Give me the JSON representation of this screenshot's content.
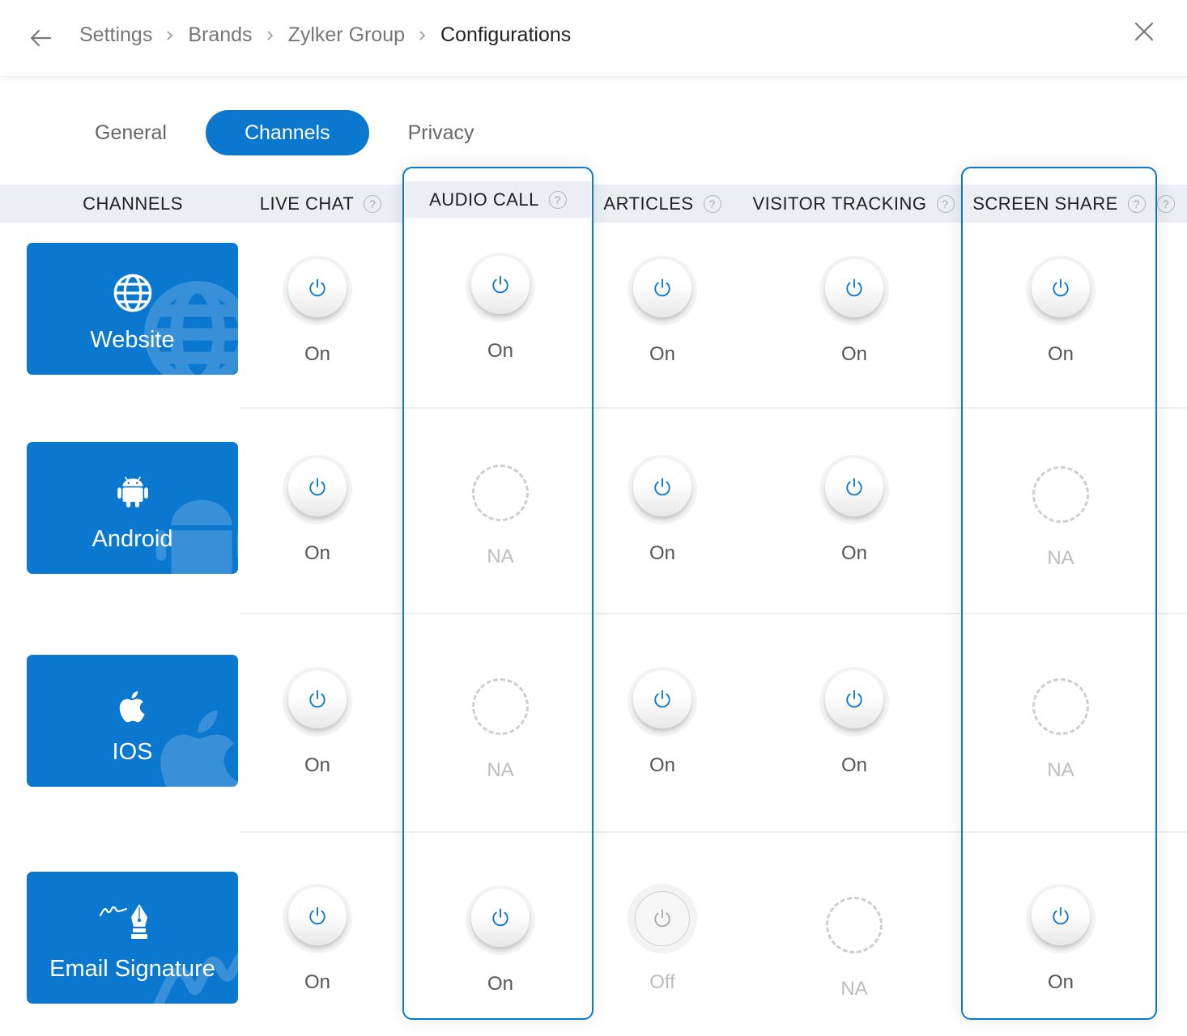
{
  "header": {
    "back_icon": "arrow-left-icon",
    "breadcrumb": [
      "Settings",
      "Brands",
      "Zylker Group",
      "Configurations"
    ],
    "close_icon": "close-icon"
  },
  "tabs": [
    {
      "label": "General",
      "active": false
    },
    {
      "label": "Channels",
      "active": true
    },
    {
      "label": "Privacy",
      "active": false
    }
  ],
  "accent_color": "#0b78d0",
  "table": {
    "channels_header": "CHANNELS",
    "columns": [
      {
        "label": "LIVE CHAT",
        "help": "?",
        "highlighted": false
      },
      {
        "label": "AUDIO CALL",
        "help": "?",
        "highlighted": true
      },
      {
        "label": "ARTICLES",
        "help": "?",
        "highlighted": false
      },
      {
        "label": "VISITOR TRACKING",
        "help": "?",
        "highlighted": false
      },
      {
        "label": "SCREEN SHARE",
        "help": "?",
        "highlighted": true
      },
      {
        "label": "",
        "help": "?",
        "highlighted": false
      }
    ],
    "rows": [
      {
        "channel": "Website",
        "icon": "globe-icon",
        "values": [
          "On",
          "On",
          "On",
          "On",
          "On"
        ]
      },
      {
        "channel": "Android",
        "icon": "android-icon",
        "values": [
          "On",
          "NA",
          "On",
          "On",
          "NA"
        ]
      },
      {
        "channel": "IOS",
        "icon": "apple-icon",
        "values": [
          "On",
          "NA",
          "On",
          "On",
          "NA"
        ]
      },
      {
        "channel": "Email Signature",
        "icon": "pen-signature-icon",
        "values": [
          "On",
          "On",
          "Off",
          "NA",
          "On"
        ]
      }
    ]
  }
}
